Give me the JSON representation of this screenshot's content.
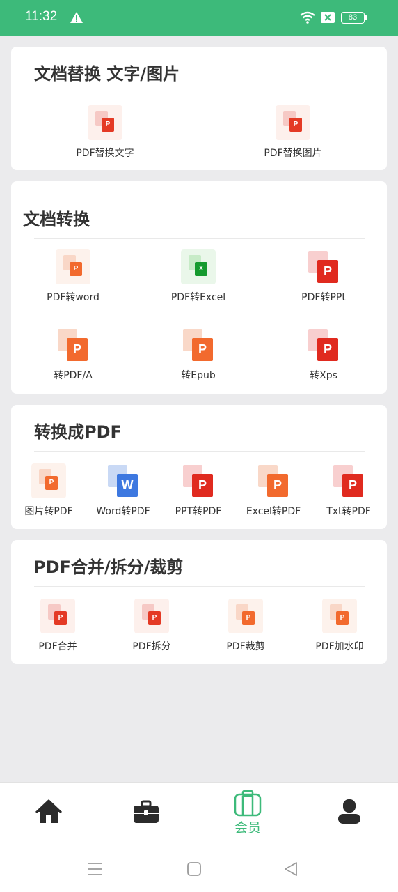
{
  "status_bar": {
    "time": "11:32",
    "battery": "83",
    "bg_color": "#3dba7a",
    "icons": [
      "warning-icon",
      "wifi-icon",
      "sim-x-icon",
      "battery-icon"
    ]
  },
  "sections": {
    "replace": {
      "title": "文档替换 文字/图片",
      "items": [
        {
          "label": "PDF替换文字",
          "icon": "pdf-replace-text-icon"
        },
        {
          "label": "PDF替换图片",
          "icon": "pdf-replace-image-icon"
        }
      ]
    },
    "convert": {
      "title": "文档转换",
      "items": [
        {
          "label": "PDF转word",
          "icon": "pdf-to-word-icon"
        },
        {
          "label": "PDF转Excel",
          "icon": "pdf-to-excel-icon"
        },
        {
          "label": "PDF转PPt",
          "icon": "pdf-to-ppt-icon"
        },
        {
          "label": "转PDF/A",
          "icon": "to-pdfa-icon"
        },
        {
          "label": "转Epub",
          "icon": "to-epub-icon"
        },
        {
          "label": "转Xps",
          "icon": "to-xps-icon"
        }
      ]
    },
    "to_pdf": {
      "title": "转换成PDF",
      "items": [
        {
          "label": "图片转PDF",
          "icon": "image-to-pdf-icon"
        },
        {
          "label": "Word转PDF",
          "icon": "word-to-pdf-icon"
        },
        {
          "label": "PPT转PDF",
          "icon": "ppt-to-pdf-icon"
        },
        {
          "label": "Excel转PDF",
          "icon": "excel-to-pdf-icon"
        },
        {
          "label": "Txt转PDF",
          "icon": "txt-to-pdf-icon"
        }
      ]
    },
    "merge": {
      "title": "PDF合并/拆分/裁剪",
      "items": [
        {
          "label": "PDF合并",
          "icon": "pdf-merge-icon"
        },
        {
          "label": "PDF拆分",
          "icon": "pdf-split-icon"
        },
        {
          "label": "PDF裁剪",
          "icon": "pdf-crop-icon"
        },
        {
          "label": "PDF加水印",
          "icon": "pdf-watermark-icon"
        }
      ]
    }
  },
  "bottom_nav": {
    "items": [
      {
        "icon": "home-icon",
        "label": ""
      },
      {
        "icon": "briefcase-icon",
        "label": ""
      },
      {
        "icon": "member-bag-icon",
        "label": "会员",
        "active": true
      },
      {
        "icon": "profile-icon",
        "label": ""
      }
    ],
    "active_color": "#3dba7a"
  },
  "system_nav": [
    "menu-icon",
    "home-square-icon",
    "back-triangle-icon"
  ]
}
